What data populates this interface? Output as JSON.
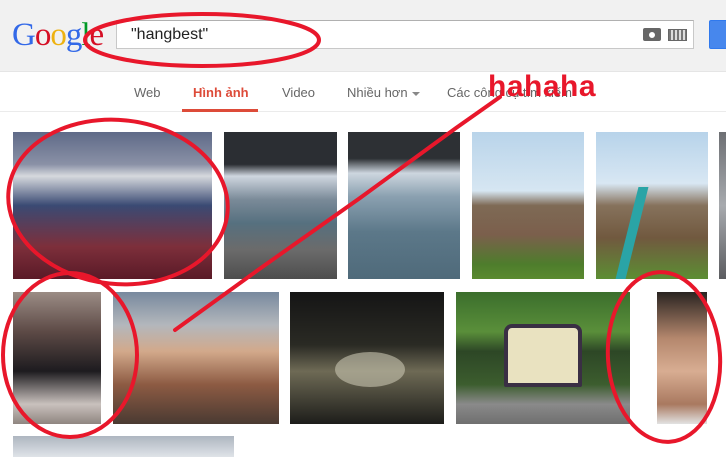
{
  "header": {
    "logo": {
      "letters": [
        {
          "ch": "G",
          "color": "#3369e8"
        },
        {
          "ch": "o",
          "color": "#d50f25"
        },
        {
          "ch": "o",
          "color": "#eeb211"
        },
        {
          "ch": "g",
          "color": "#3369e8"
        },
        {
          "ch": "l",
          "color": "#009925"
        },
        {
          "ch": "e",
          "color": "#d50f25"
        }
      ]
    },
    "search": {
      "query": "\"hangbest\"",
      "camera_icon": "camera-icon",
      "keyboard_icon": "keyboard-icon"
    }
  },
  "nav": {
    "tabs": [
      {
        "label": "Web",
        "active": false
      },
      {
        "label": "Hình ảnh",
        "active": true
      },
      {
        "label": "Video",
        "active": false
      },
      {
        "label": "Nhiều hơn",
        "active": false,
        "dropdown": true
      },
      {
        "label": "Các công cụ tìm kiếm",
        "active": false
      }
    ]
  },
  "results": {
    "rows": [
      {
        "items": [
          "people-at-dinner-table",
          "lake-with-railing",
          "lake-view",
          "marsh-field",
          "marsh-with-rail",
          "partial-image"
        ]
      },
      {
        "items": [
          "woman-and-man",
          "dinner-party",
          "dark-table-with-bottle",
          "vintage-bus",
          "man-face-closeup"
        ]
      },
      {
        "items": [
          "partial-image-bottom"
        ]
      }
    ]
  },
  "annotation": {
    "text": "hahaha",
    "color": "#e8172b"
  }
}
